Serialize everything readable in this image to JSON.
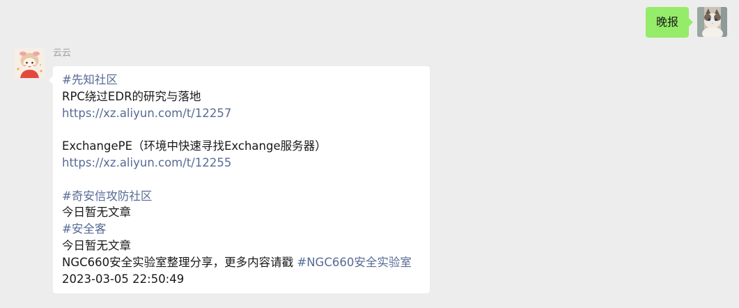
{
  "outgoing": {
    "text": "晚报"
  },
  "incoming": {
    "sender": "云云",
    "lines": [
      {
        "text": "#先知社区",
        "kind": "tag"
      },
      {
        "text": "RPC绕过EDR的研究与落地",
        "kind": "text"
      },
      {
        "text": "https://xz.aliyun.com/t/12257",
        "kind": "link"
      },
      {
        "text": "",
        "kind": "blank"
      },
      {
        "text": "ExchangePE（环境中快速寻找Exchange服务器）",
        "kind": "text"
      },
      {
        "text": "https://xz.aliyun.com/t/12255",
        "kind": "link"
      },
      {
        "text": "",
        "kind": "blank"
      },
      {
        "text": "#奇安信攻防社区",
        "kind": "tag"
      },
      {
        "text": "今日暂无文章",
        "kind": "text"
      },
      {
        "text": "#安全客",
        "kind": "tag"
      },
      {
        "text": "今日暂无文章",
        "kind": "text"
      },
      {
        "text": "NGC660安全实验室整理分享，更多内容请戳 ",
        "kind": "text",
        "tail": "#NGC660安全实验室"
      },
      {
        "text": "2023-03-05 22:50:49",
        "kind": "text"
      }
    ]
  },
  "colors": {
    "background": "#ededed",
    "outgoing_bubble": "#95ec69",
    "incoming_bubble": "#ffffff",
    "link": "#576b95",
    "sender_name": "#a0a0a0"
  },
  "icons": {
    "outgoing_avatar": "cat-photo-avatar",
    "incoming_avatar": "cartoon-girl-avatar"
  }
}
